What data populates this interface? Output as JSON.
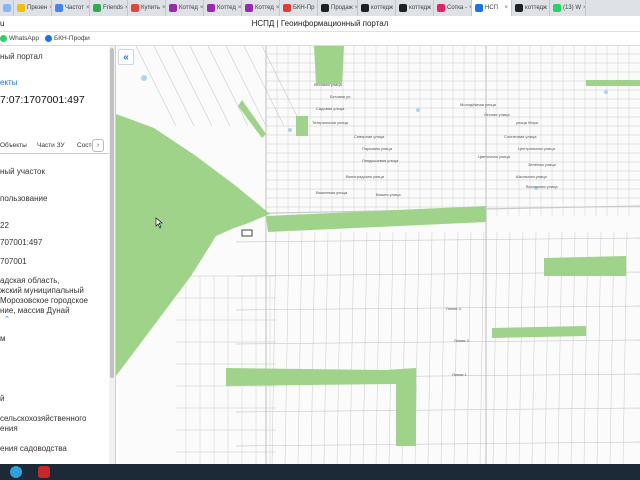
{
  "browser": {
    "tabs": [
      {
        "label": "u",
        "color": "#8ab4f8"
      },
      {
        "label": "Презен",
        "color": "#fbbc04"
      },
      {
        "label": "Частот",
        "color": "#4285f4"
      },
      {
        "label": "Friends",
        "color": "#34a853"
      },
      {
        "label": "Купить",
        "color": "#ea4335"
      },
      {
        "label": "Коттед",
        "color": "#9c27b0"
      },
      {
        "label": "Коттед",
        "color": "#9c27b0"
      },
      {
        "label": "Коттед",
        "color": "#9c27b0"
      },
      {
        "label": "БКН-Пр",
        "color": "#e53935"
      },
      {
        "label": "Продаж",
        "color": "#202124"
      },
      {
        "label": "коттедж",
        "color": "#202124"
      },
      {
        "label": "коттедж",
        "color": "#202124"
      },
      {
        "label": "Сотка -",
        "color": "#e91e63"
      },
      {
        "label": "НСП",
        "color": "#1a73e8",
        "active": true
      },
      {
        "label": "коттедж",
        "color": "#202124"
      },
      {
        "label": "(13) W",
        "color": "#25d366"
      }
    ],
    "url_fragment": "u",
    "page_title": "НСПД | Геоинформационный портал",
    "bookmarks": [
      {
        "label": "WhatsApp",
        "color": "#25d366"
      },
      {
        "label": "БКН-Профи",
        "color": "#1a73e8"
      }
    ]
  },
  "panel": {
    "portal_title": "ный портал",
    "objects_link": "екты",
    "cadastral_number_header": "7:07:1707001:497",
    "tabs": [
      "Объекты",
      "Части ЗУ",
      "Состо"
    ],
    "next_tab_label": "›",
    "fields": {
      "type": "ный участок",
      "use_label": "пользование",
      "area_value": "22",
      "cad_number": "707001:497",
      "quarter": "707001",
      "address_1": "адская область,",
      "address_2": "жский муниципальный",
      "address_3": "Морозовское городское",
      "address_4": "ние, массив Дунай",
      "unit": "м",
      "category_1": "й",
      "category_2": "сельскохозяйственного",
      "category_3": "ения",
      "permitted_use": "ения садоводства"
    },
    "expand_icon": "chevron-up-icon"
  },
  "map": {
    "collapse_icon": "chevron-double-left-icon",
    "street_labels": [
      "Весовая улица",
      "Беговая ул.",
      "Садовая улица",
      "Театральная улица",
      "Северная улица",
      "Парковая улица",
      "Ландышевая улица",
      "Виноградская улица",
      "Вишневая улица",
      "Вишня улица",
      "Солнечная улица",
      "улица Мира",
      "Центральная улица",
      "Зелёная улица",
      "Школьная улица",
      "Восточная улица",
      "Молодёжная улица",
      "Лесная улица",
      "Цветочная улица"
    ],
    "numbered_labels": [
      "Линия 3",
      "Линия 2",
      "Линия 1"
    ],
    "colors": {
      "forest": "#9fd38a",
      "field": "#fbfbfb",
      "road": "#c9c9c9",
      "water": "#a8d5f2"
    }
  },
  "taskbar": {
    "icons": [
      "telegram-icon",
      "app-icon"
    ]
  }
}
